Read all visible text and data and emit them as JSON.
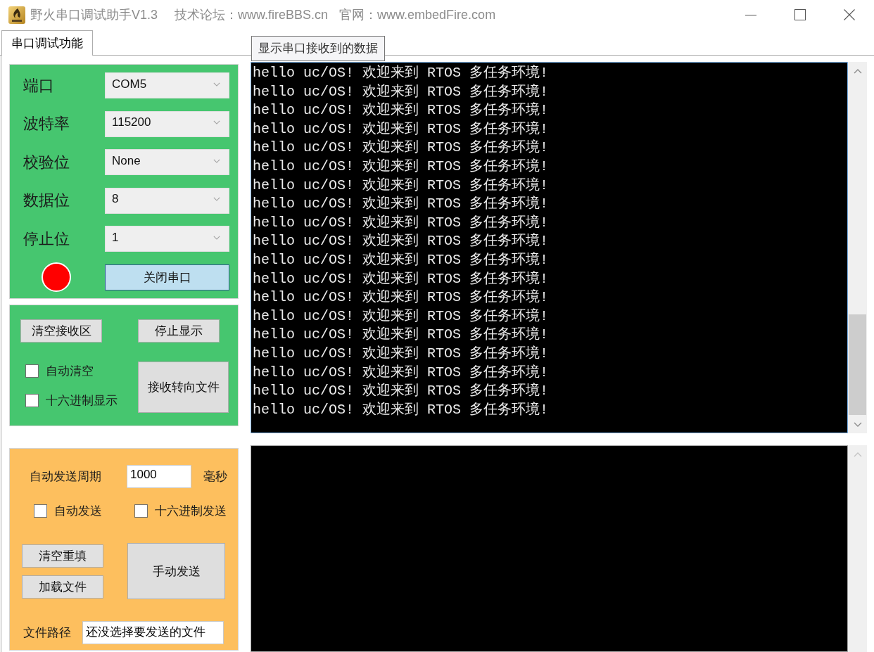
{
  "window": {
    "title": "野火串口调试助手V1.3",
    "forum": "技术论坛：www.fireBBS.cn",
    "website": "官网：www.embedFire.com"
  },
  "tabs": [
    {
      "label": "串口调试功能",
      "selected": true
    }
  ],
  "tooltip": "显示串口接收到的数据",
  "port_settings": {
    "fields": [
      {
        "label": "端口",
        "value": "COM5"
      },
      {
        "label": "波特率",
        "value": "115200"
      },
      {
        "label": "校验位",
        "value": "None"
      },
      {
        "label": "数据位",
        "value": "8"
      },
      {
        "label": "停止位",
        "value": "1"
      }
    ],
    "port_open": true,
    "toggle_button": "关闭串口"
  },
  "receive_controls": {
    "buttons": [
      "清空接收区",
      "停止显示"
    ],
    "options": [
      {
        "label": "自动清空",
        "checked": false
      },
      {
        "label": "十六进制显示",
        "checked": false
      }
    ],
    "redirect_button": "接收转向文件"
  },
  "send_controls": {
    "period": {
      "label": "自动发送周期",
      "value": "1000",
      "unit": "毫秒"
    },
    "options": [
      {
        "label": "自动发送",
        "checked": false
      },
      {
        "label": "十六进制发送",
        "checked": false
      }
    ],
    "buttons": [
      "清空重填",
      "加载文件"
    ],
    "send_button": "手动发送",
    "file": {
      "label": "文件路径",
      "value": "还没选择要发送的文件"
    }
  },
  "receive_area": {
    "lines": [
      "hello uc/OS! 欢迎来到 RTOS 多任务环境!",
      "hello uc/OS! 欢迎来到 RTOS 多任务环境!",
      "hello uc/OS! 欢迎来到 RTOS 多任务环境!",
      "hello uc/OS! 欢迎来到 RTOS 多任务环境!",
      "hello uc/OS! 欢迎来到 RTOS 多任务环境!",
      "hello uc/OS! 欢迎来到 RTOS 多任务环境!",
      "hello uc/OS! 欢迎来到 RTOS 多任务环境!",
      "hello uc/OS! 欢迎来到 RTOS 多任务环境!",
      "hello uc/OS! 欢迎来到 RTOS 多任务环境!",
      "hello uc/OS! 欢迎来到 RTOS 多任务环境!",
      "hello uc/OS! 欢迎来到 RTOS 多任务环境!",
      "hello uc/OS! 欢迎来到 RTOS 多任务环境!",
      "hello uc/OS! 欢迎来到 RTOS 多任务环境!",
      "hello uc/OS! 欢迎来到 RTOS 多任务环境!",
      "hello uc/OS! 欢迎来到 RTOS 多任务环境!",
      "hello uc/OS! 欢迎来到 RTOS 多任务环境!",
      "hello uc/OS! 欢迎来到 RTOS 多任务环境!",
      "hello uc/OS! 欢迎来到 RTOS 多任务环境!",
      "hello uc/OS! 欢迎来到 RTOS 多任务环境!"
    ]
  }
}
